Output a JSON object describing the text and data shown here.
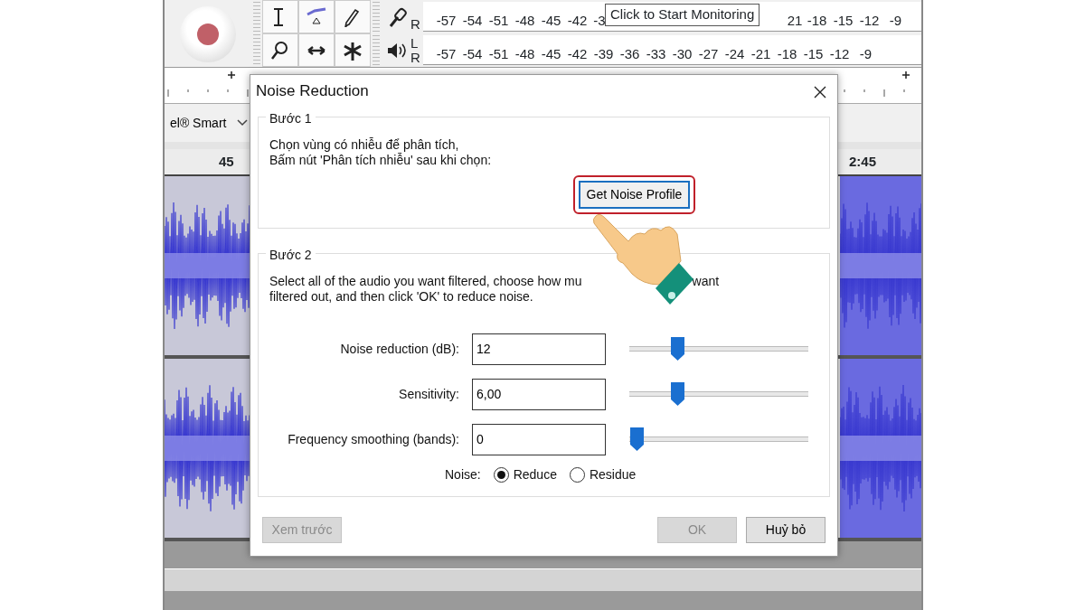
{
  "toolbar": {
    "meters": [
      {
        "kind": "record",
        "channels": [
          "R"
        ],
        "ticks_before": [
          "-57",
          "-54",
          "-51",
          "-48",
          "-45",
          "-42",
          "-3"
        ],
        "tooltip": "Click to Start Monitoring",
        "ticks_after": [
          "21",
          "-18",
          "-15",
          "-12",
          "-9"
        ]
      },
      {
        "kind": "playback",
        "channels": [
          "L",
          "R"
        ],
        "ticks_before": [
          "-57",
          "-54",
          "-51",
          "-48",
          "-45",
          "-42",
          "-39",
          "-36",
          "-33",
          "-30",
          "-27",
          "-24",
          "-21",
          "-18",
          "-15",
          "-12",
          "-9"
        ]
      }
    ]
  },
  "device": {
    "value": "el® Smart"
  },
  "timeline": {
    "left_label": "45",
    "right_label": "2:45"
  },
  "dialog": {
    "title": "Noise Reduction",
    "step1": {
      "title": "Bước 1",
      "lines": [
        "Chọn vùng có nhiễu để phân tích,",
        "Bấm nút 'Phân tích nhiễu' sau khi chọn:"
      ],
      "button": "Get Noise Profile",
      "highlighted": true
    },
    "step2": {
      "title": "Bước 2",
      "line1_start": "Select all of the audio you want filtered, choose how mu",
      "line1_end": "want",
      "line2": "filtered out, and then click 'OK' to reduce noise.",
      "fields": [
        {
          "label": "Noise reduction (dB):",
          "value": "12",
          "level": 0.27
        },
        {
          "label": "Sensitivity:",
          "value": "6,00",
          "level": 0.27
        },
        {
          "label": "Frequency smoothing (bands):",
          "value": "0",
          "level": 0
        }
      ],
      "noise": {
        "label": "Noise:",
        "options": [
          {
            "label": "Reduce",
            "selected": true
          },
          {
            "label": "Residue",
            "selected": false
          }
        ]
      }
    },
    "buttons": [
      {
        "label": "Xem trước",
        "disabled": true
      },
      {
        "label": "OK",
        "disabled": true
      },
      {
        "label": "Huỷ bỏ",
        "disabled": false
      }
    ]
  }
}
